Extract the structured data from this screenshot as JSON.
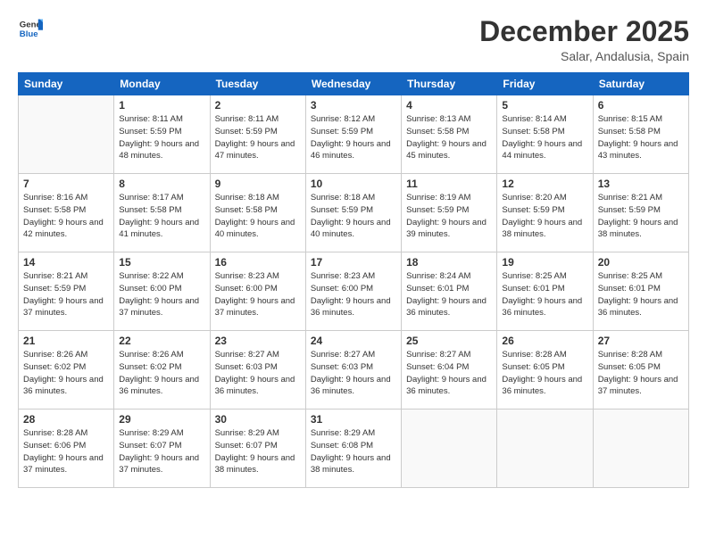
{
  "logo": {
    "line1": "General",
    "line2": "Blue"
  },
  "header": {
    "month": "December 2025",
    "location": "Salar, Andalusia, Spain"
  },
  "weekdays": [
    "Sunday",
    "Monday",
    "Tuesday",
    "Wednesday",
    "Thursday",
    "Friday",
    "Saturday"
  ],
  "weeks": [
    [
      {
        "day": "",
        "info": ""
      },
      {
        "day": "1",
        "info": "Sunrise: 8:11 AM\nSunset: 5:59 PM\nDaylight: 9 hours\nand 48 minutes."
      },
      {
        "day": "2",
        "info": "Sunrise: 8:11 AM\nSunset: 5:59 PM\nDaylight: 9 hours\nand 47 minutes."
      },
      {
        "day": "3",
        "info": "Sunrise: 8:12 AM\nSunset: 5:59 PM\nDaylight: 9 hours\nand 46 minutes."
      },
      {
        "day": "4",
        "info": "Sunrise: 8:13 AM\nSunset: 5:58 PM\nDaylight: 9 hours\nand 45 minutes."
      },
      {
        "day": "5",
        "info": "Sunrise: 8:14 AM\nSunset: 5:58 PM\nDaylight: 9 hours\nand 44 minutes."
      },
      {
        "day": "6",
        "info": "Sunrise: 8:15 AM\nSunset: 5:58 PM\nDaylight: 9 hours\nand 43 minutes."
      }
    ],
    [
      {
        "day": "7",
        "info": "Sunrise: 8:16 AM\nSunset: 5:58 PM\nDaylight: 9 hours\nand 42 minutes."
      },
      {
        "day": "8",
        "info": "Sunrise: 8:17 AM\nSunset: 5:58 PM\nDaylight: 9 hours\nand 41 minutes."
      },
      {
        "day": "9",
        "info": "Sunrise: 8:18 AM\nSunset: 5:58 PM\nDaylight: 9 hours\nand 40 minutes."
      },
      {
        "day": "10",
        "info": "Sunrise: 8:18 AM\nSunset: 5:59 PM\nDaylight: 9 hours\nand 40 minutes."
      },
      {
        "day": "11",
        "info": "Sunrise: 8:19 AM\nSunset: 5:59 PM\nDaylight: 9 hours\nand 39 minutes."
      },
      {
        "day": "12",
        "info": "Sunrise: 8:20 AM\nSunset: 5:59 PM\nDaylight: 9 hours\nand 38 minutes."
      },
      {
        "day": "13",
        "info": "Sunrise: 8:21 AM\nSunset: 5:59 PM\nDaylight: 9 hours\nand 38 minutes."
      }
    ],
    [
      {
        "day": "14",
        "info": "Sunrise: 8:21 AM\nSunset: 5:59 PM\nDaylight: 9 hours\nand 37 minutes."
      },
      {
        "day": "15",
        "info": "Sunrise: 8:22 AM\nSunset: 6:00 PM\nDaylight: 9 hours\nand 37 minutes."
      },
      {
        "day": "16",
        "info": "Sunrise: 8:23 AM\nSunset: 6:00 PM\nDaylight: 9 hours\nand 37 minutes."
      },
      {
        "day": "17",
        "info": "Sunrise: 8:23 AM\nSunset: 6:00 PM\nDaylight: 9 hours\nand 36 minutes."
      },
      {
        "day": "18",
        "info": "Sunrise: 8:24 AM\nSunset: 6:01 PM\nDaylight: 9 hours\nand 36 minutes."
      },
      {
        "day": "19",
        "info": "Sunrise: 8:25 AM\nSunset: 6:01 PM\nDaylight: 9 hours\nand 36 minutes."
      },
      {
        "day": "20",
        "info": "Sunrise: 8:25 AM\nSunset: 6:01 PM\nDaylight: 9 hours\nand 36 minutes."
      }
    ],
    [
      {
        "day": "21",
        "info": "Sunrise: 8:26 AM\nSunset: 6:02 PM\nDaylight: 9 hours\nand 36 minutes."
      },
      {
        "day": "22",
        "info": "Sunrise: 8:26 AM\nSunset: 6:02 PM\nDaylight: 9 hours\nand 36 minutes."
      },
      {
        "day": "23",
        "info": "Sunrise: 8:27 AM\nSunset: 6:03 PM\nDaylight: 9 hours\nand 36 minutes."
      },
      {
        "day": "24",
        "info": "Sunrise: 8:27 AM\nSunset: 6:03 PM\nDaylight: 9 hours\nand 36 minutes."
      },
      {
        "day": "25",
        "info": "Sunrise: 8:27 AM\nSunset: 6:04 PM\nDaylight: 9 hours\nand 36 minutes."
      },
      {
        "day": "26",
        "info": "Sunrise: 8:28 AM\nSunset: 6:05 PM\nDaylight: 9 hours\nand 36 minutes."
      },
      {
        "day": "27",
        "info": "Sunrise: 8:28 AM\nSunset: 6:05 PM\nDaylight: 9 hours\nand 37 minutes."
      }
    ],
    [
      {
        "day": "28",
        "info": "Sunrise: 8:28 AM\nSunset: 6:06 PM\nDaylight: 9 hours\nand 37 minutes."
      },
      {
        "day": "29",
        "info": "Sunrise: 8:29 AM\nSunset: 6:07 PM\nDaylight: 9 hours\nand 37 minutes."
      },
      {
        "day": "30",
        "info": "Sunrise: 8:29 AM\nSunset: 6:07 PM\nDaylight: 9 hours\nand 38 minutes."
      },
      {
        "day": "31",
        "info": "Sunrise: 8:29 AM\nSunset: 6:08 PM\nDaylight: 9 hours\nand 38 minutes."
      },
      {
        "day": "",
        "info": ""
      },
      {
        "day": "",
        "info": ""
      },
      {
        "day": "",
        "info": ""
      }
    ]
  ]
}
